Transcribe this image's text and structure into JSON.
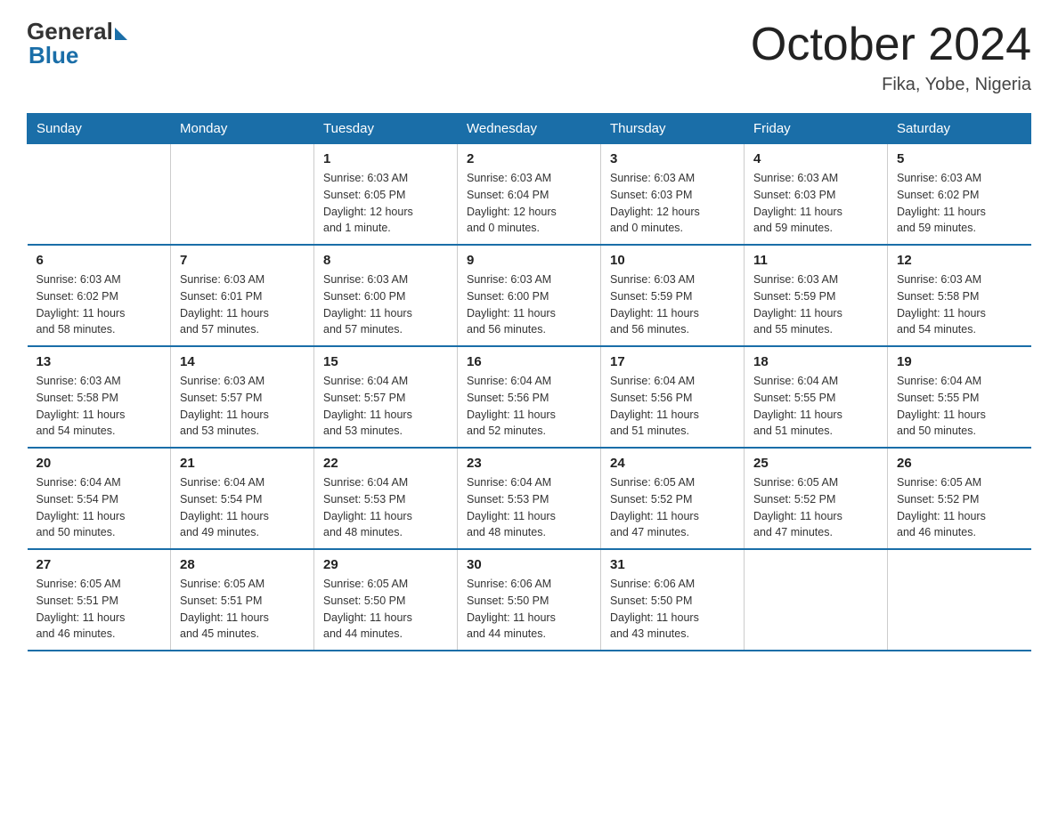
{
  "header": {
    "logo_general": "General",
    "logo_blue": "Blue",
    "month_title": "October 2024",
    "location": "Fika, Yobe, Nigeria"
  },
  "days_of_week": [
    "Sunday",
    "Monday",
    "Tuesday",
    "Wednesday",
    "Thursday",
    "Friday",
    "Saturday"
  ],
  "weeks": [
    [
      {
        "num": "",
        "info": ""
      },
      {
        "num": "",
        "info": ""
      },
      {
        "num": "1",
        "info": "Sunrise: 6:03 AM\nSunset: 6:05 PM\nDaylight: 12 hours\nand 1 minute."
      },
      {
        "num": "2",
        "info": "Sunrise: 6:03 AM\nSunset: 6:04 PM\nDaylight: 12 hours\nand 0 minutes."
      },
      {
        "num": "3",
        "info": "Sunrise: 6:03 AM\nSunset: 6:03 PM\nDaylight: 12 hours\nand 0 minutes."
      },
      {
        "num": "4",
        "info": "Sunrise: 6:03 AM\nSunset: 6:03 PM\nDaylight: 11 hours\nand 59 minutes."
      },
      {
        "num": "5",
        "info": "Sunrise: 6:03 AM\nSunset: 6:02 PM\nDaylight: 11 hours\nand 59 minutes."
      }
    ],
    [
      {
        "num": "6",
        "info": "Sunrise: 6:03 AM\nSunset: 6:02 PM\nDaylight: 11 hours\nand 58 minutes."
      },
      {
        "num": "7",
        "info": "Sunrise: 6:03 AM\nSunset: 6:01 PM\nDaylight: 11 hours\nand 57 minutes."
      },
      {
        "num": "8",
        "info": "Sunrise: 6:03 AM\nSunset: 6:00 PM\nDaylight: 11 hours\nand 57 minutes."
      },
      {
        "num": "9",
        "info": "Sunrise: 6:03 AM\nSunset: 6:00 PM\nDaylight: 11 hours\nand 56 minutes."
      },
      {
        "num": "10",
        "info": "Sunrise: 6:03 AM\nSunset: 5:59 PM\nDaylight: 11 hours\nand 56 minutes."
      },
      {
        "num": "11",
        "info": "Sunrise: 6:03 AM\nSunset: 5:59 PM\nDaylight: 11 hours\nand 55 minutes."
      },
      {
        "num": "12",
        "info": "Sunrise: 6:03 AM\nSunset: 5:58 PM\nDaylight: 11 hours\nand 54 minutes."
      }
    ],
    [
      {
        "num": "13",
        "info": "Sunrise: 6:03 AM\nSunset: 5:58 PM\nDaylight: 11 hours\nand 54 minutes."
      },
      {
        "num": "14",
        "info": "Sunrise: 6:03 AM\nSunset: 5:57 PM\nDaylight: 11 hours\nand 53 minutes."
      },
      {
        "num": "15",
        "info": "Sunrise: 6:04 AM\nSunset: 5:57 PM\nDaylight: 11 hours\nand 53 minutes."
      },
      {
        "num": "16",
        "info": "Sunrise: 6:04 AM\nSunset: 5:56 PM\nDaylight: 11 hours\nand 52 minutes."
      },
      {
        "num": "17",
        "info": "Sunrise: 6:04 AM\nSunset: 5:56 PM\nDaylight: 11 hours\nand 51 minutes."
      },
      {
        "num": "18",
        "info": "Sunrise: 6:04 AM\nSunset: 5:55 PM\nDaylight: 11 hours\nand 51 minutes."
      },
      {
        "num": "19",
        "info": "Sunrise: 6:04 AM\nSunset: 5:55 PM\nDaylight: 11 hours\nand 50 minutes."
      }
    ],
    [
      {
        "num": "20",
        "info": "Sunrise: 6:04 AM\nSunset: 5:54 PM\nDaylight: 11 hours\nand 50 minutes."
      },
      {
        "num": "21",
        "info": "Sunrise: 6:04 AM\nSunset: 5:54 PM\nDaylight: 11 hours\nand 49 minutes."
      },
      {
        "num": "22",
        "info": "Sunrise: 6:04 AM\nSunset: 5:53 PM\nDaylight: 11 hours\nand 48 minutes."
      },
      {
        "num": "23",
        "info": "Sunrise: 6:04 AM\nSunset: 5:53 PM\nDaylight: 11 hours\nand 48 minutes."
      },
      {
        "num": "24",
        "info": "Sunrise: 6:05 AM\nSunset: 5:52 PM\nDaylight: 11 hours\nand 47 minutes."
      },
      {
        "num": "25",
        "info": "Sunrise: 6:05 AM\nSunset: 5:52 PM\nDaylight: 11 hours\nand 47 minutes."
      },
      {
        "num": "26",
        "info": "Sunrise: 6:05 AM\nSunset: 5:52 PM\nDaylight: 11 hours\nand 46 minutes."
      }
    ],
    [
      {
        "num": "27",
        "info": "Sunrise: 6:05 AM\nSunset: 5:51 PM\nDaylight: 11 hours\nand 46 minutes."
      },
      {
        "num": "28",
        "info": "Sunrise: 6:05 AM\nSunset: 5:51 PM\nDaylight: 11 hours\nand 45 minutes."
      },
      {
        "num": "29",
        "info": "Sunrise: 6:05 AM\nSunset: 5:50 PM\nDaylight: 11 hours\nand 44 minutes."
      },
      {
        "num": "30",
        "info": "Sunrise: 6:06 AM\nSunset: 5:50 PM\nDaylight: 11 hours\nand 44 minutes."
      },
      {
        "num": "31",
        "info": "Sunrise: 6:06 AM\nSunset: 5:50 PM\nDaylight: 11 hours\nand 43 minutes."
      },
      {
        "num": "",
        "info": ""
      },
      {
        "num": "",
        "info": ""
      }
    ]
  ]
}
